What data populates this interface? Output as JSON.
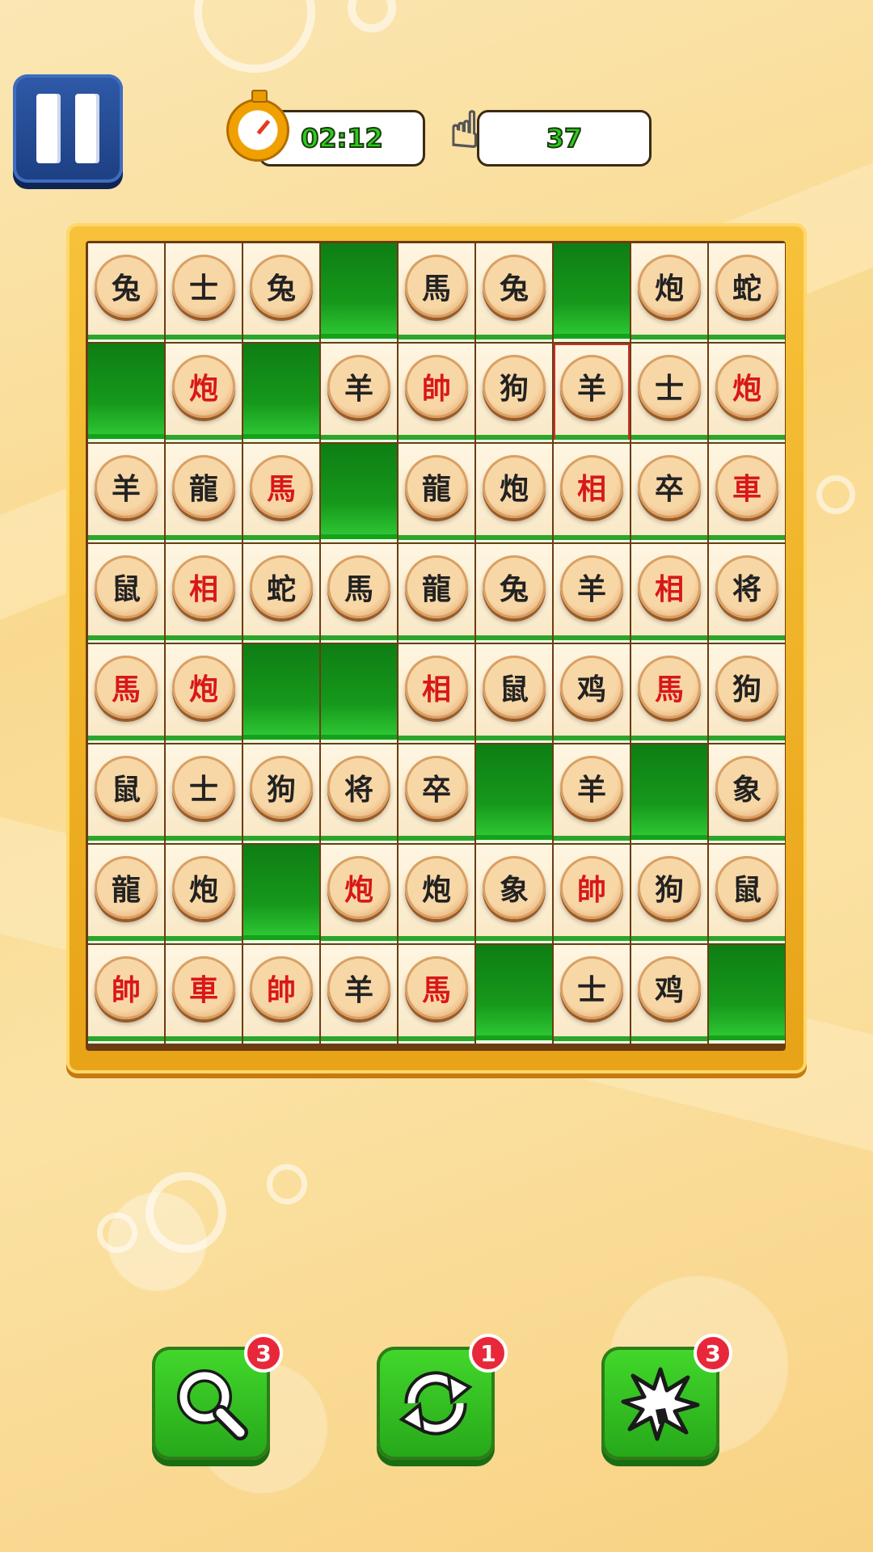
{
  "hud": {
    "timer": "02:12",
    "moves": "37"
  },
  "board": {
    "rows": [
      [
        {
          "c": "兔",
          "r": false
        },
        {
          "c": "士",
          "r": false
        },
        {
          "c": "兔",
          "r": false
        },
        null,
        {
          "c": "馬",
          "r": false
        },
        {
          "c": "兔",
          "r": false
        },
        null,
        {
          "c": "炮",
          "r": false
        },
        {
          "c": "蛇",
          "r": false
        }
      ],
      [
        null,
        {
          "c": "炮",
          "r": true
        },
        null,
        {
          "c": "羊",
          "r": false
        },
        {
          "c": "帥",
          "r": true
        },
        {
          "c": "狗",
          "r": false
        },
        {
          "c": "羊",
          "r": false,
          "sel": true
        },
        {
          "c": "士",
          "r": false
        },
        {
          "c": "炮",
          "r": true
        }
      ],
      [
        {
          "c": "羊",
          "r": false
        },
        {
          "c": "龍",
          "r": false
        },
        {
          "c": "馬",
          "r": true
        },
        null,
        {
          "c": "龍",
          "r": false
        },
        {
          "c": "炮",
          "r": false
        },
        {
          "c": "相",
          "r": true
        },
        {
          "c": "卒",
          "r": false
        },
        {
          "c": "車",
          "r": true
        }
      ],
      [
        {
          "c": "鼠",
          "r": false
        },
        {
          "c": "相",
          "r": true
        },
        {
          "c": "蛇",
          "r": false
        },
        {
          "c": "馬",
          "r": false
        },
        {
          "c": "龍",
          "r": false
        },
        {
          "c": "兔",
          "r": false
        },
        {
          "c": "羊",
          "r": false
        },
        {
          "c": "相",
          "r": true
        },
        {
          "c": "将",
          "r": false
        }
      ],
      [
        {
          "c": "馬",
          "r": true
        },
        {
          "c": "炮",
          "r": true
        },
        null,
        null,
        {
          "c": "相",
          "r": true
        },
        {
          "c": "鼠",
          "r": false
        },
        {
          "c": "鸡",
          "r": false
        },
        {
          "c": "馬",
          "r": true
        },
        {
          "c": "狗",
          "r": false
        }
      ],
      [
        {
          "c": "鼠",
          "r": false
        },
        {
          "c": "士",
          "r": false
        },
        {
          "c": "狗",
          "r": false
        },
        {
          "c": "将",
          "r": false
        },
        {
          "c": "卒",
          "r": false
        },
        null,
        {
          "c": "羊",
          "r": false
        },
        null,
        {
          "c": "象",
          "r": false
        }
      ],
      [
        {
          "c": "龍",
          "r": false
        },
        {
          "c": "炮",
          "r": false
        },
        null,
        {
          "c": "炮",
          "r": true
        },
        {
          "c": "炮",
          "r": false
        },
        {
          "c": "象",
          "r": false
        },
        {
          "c": "帥",
          "r": true
        },
        {
          "c": "狗",
          "r": false
        },
        {
          "c": "鼠",
          "r": false
        }
      ],
      [
        {
          "c": "帥",
          "r": true
        },
        {
          "c": "車",
          "r": true
        },
        {
          "c": "帥",
          "r": true
        },
        {
          "c": "羊",
          "r": false
        },
        {
          "c": "馬",
          "r": true
        },
        null,
        {
          "c": "士",
          "r": false
        },
        {
          "c": "鸡",
          "r": false
        },
        null
      ]
    ]
  },
  "powerups": [
    {
      "name": "hint",
      "icon": "magnifier-icon",
      "count": "3"
    },
    {
      "name": "shuffle",
      "icon": "shuffle-icon",
      "count": "1"
    },
    {
      "name": "bomb",
      "icon": "explosion-icon",
      "count": "3"
    }
  ],
  "colors": {
    "empty_tile": "#16981b",
    "red_glyph": "#d81818",
    "board_frame": "#f7c23a"
  }
}
